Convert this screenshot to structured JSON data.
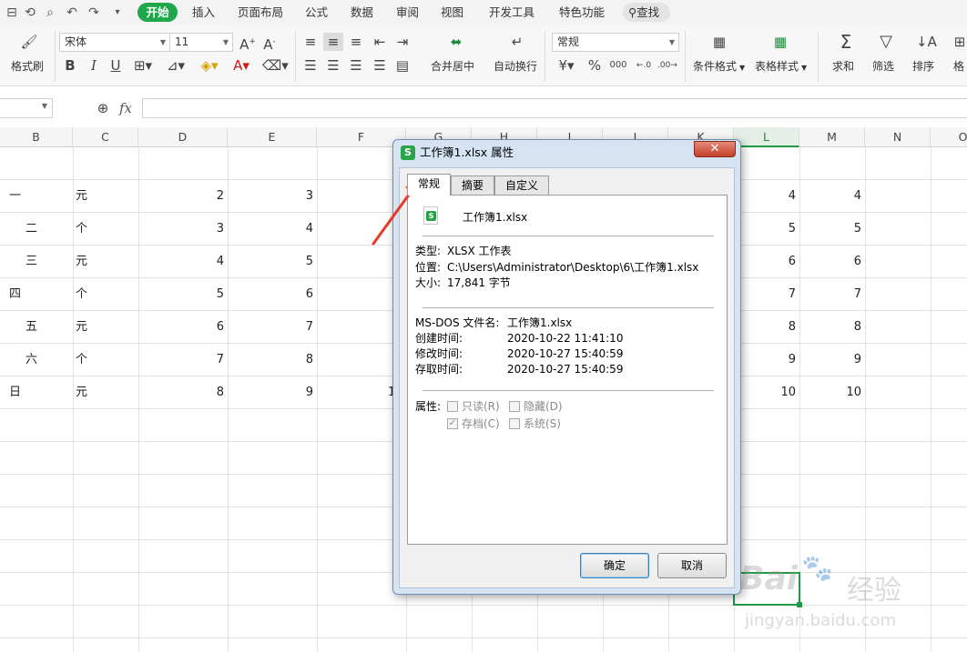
{
  "menu": {
    "tabs": [
      "插入",
      "页面布局",
      "公式",
      "数据",
      "审阅",
      "视图",
      "开发工具",
      "特色功能"
    ],
    "active": "开始",
    "search": "查找"
  },
  "ribbon": {
    "format_painter": "格式刷",
    "font_name": "宋体",
    "font_size": "11",
    "number_format": "常规",
    "merge_center": "合并居中",
    "wrap_text": "自动换行",
    "conditional_format": "条件格式",
    "table_style": "表格样式",
    "sum": "求和",
    "filter": "筛选",
    "sort": "排序",
    "format_truncated": "格"
  },
  "formula_bar": {
    "fx": "fx"
  },
  "columns": [
    "B",
    "C",
    "D",
    "E",
    "F",
    "G",
    "H",
    "I",
    "J",
    "K",
    "L",
    "M",
    "N",
    "O"
  ],
  "rows": [
    {
      "b": "一",
      "c": "元",
      "d": "2",
      "e": "3",
      "l": "4",
      "m": "4"
    },
    {
      "b": "二",
      "c": "个",
      "d": "3",
      "e": "4",
      "l": "5",
      "m": "5"
    },
    {
      "b": "三",
      "c": "元",
      "d": "4",
      "e": "5",
      "l": "6",
      "m": "6"
    },
    {
      "b": "四",
      "c": "个",
      "d": "5",
      "e": "6",
      "l": "7",
      "m": "7"
    },
    {
      "b": "五",
      "c": "元",
      "d": "6",
      "e": "7",
      "l": "8",
      "m": "8"
    },
    {
      "b": "六",
      "c": "个",
      "d": "7",
      "e": "8",
      "l": "9",
      "m": "9"
    },
    {
      "b": "日",
      "c": "元",
      "d": "8",
      "e": "9",
      "f": "1",
      "l": "10",
      "m": "10"
    }
  ],
  "dialog": {
    "title": "工作簿1.xlsx 属性",
    "close": "✕",
    "tabs": [
      "常规",
      "摘要",
      "自定义"
    ],
    "file_name": "工作簿1.xlsx",
    "type_label": "类型:",
    "type_value": "XLSX 工作表",
    "location_label": "位置:",
    "location_value": "C:\\Users\\Administrator\\Desktop\\6\\工作簿1.xlsx",
    "size_label": "大小:",
    "size_value": "17,841 字节",
    "msdos_label": "MS-DOS 文件名:",
    "msdos_value": "工作簿1.xlsx",
    "created_label": "创建时间:",
    "created_value": "2020-10-22 11:41:10",
    "modified_label": "修改时间:",
    "modified_value": "2020-10-27 15:40:59",
    "accessed_label": "存取时间:",
    "accessed_value": "2020-10-27 15:40:59",
    "attr_label": "属性:",
    "readonly": "只读(R)",
    "hidden": "隐藏(D)",
    "archive": "存档(C)",
    "system": "系统(S)",
    "ok": "确定",
    "cancel": "取消"
  },
  "watermark": {
    "brand": "Bai",
    "brand2": "经验",
    "url": "jingyan.baidu.com"
  },
  "colors": {
    "accent": "#1fa84b",
    "arrow": "#e8392b",
    "dialog_frame": "#d5e3f3"
  }
}
